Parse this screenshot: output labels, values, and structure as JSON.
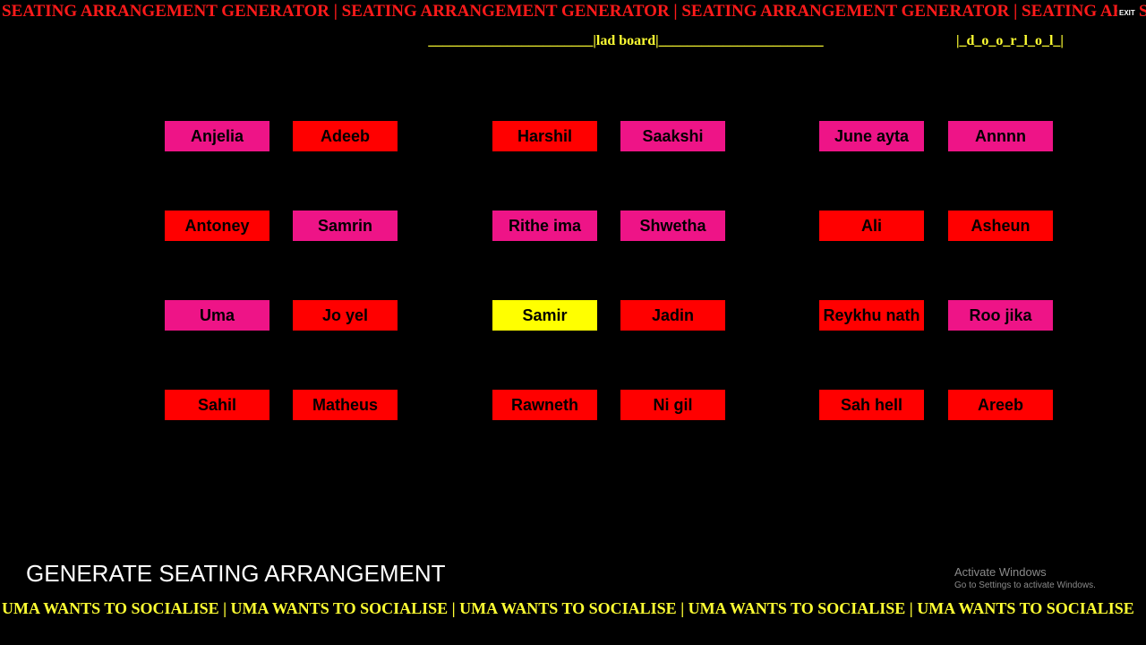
{
  "header": {
    "marquee_text": "SEATING ARRANGEMENT GENERATOR | SEATING ARRANGEMENT GENERATOR | SEATING ARRANGEMENT GENERATOR | SEATING ARRAN",
    "marquee_tail": "S",
    "exit_label": "EXIT",
    "board_label": "_______________________|lad board|_______________________",
    "door_label": "|_d_o_o_r_l_o_l_|"
  },
  "colors": {
    "red": "#ff0000",
    "pink": "#ee1487",
    "yellow": "#ffff00",
    "marquee_top": "#ff1a1a",
    "marquee_bottom": "#ffff33"
  },
  "seats": [
    [
      "Anjelia",
      "Adeeb",
      "Harshil",
      "Saakshi",
      "June ayta",
      "Annnn"
    ],
    [
      "Antoney",
      "Samrin",
      "Rithe ima",
      "Shwetha",
      "Ali",
      "Asheun"
    ],
    [
      "Uma",
      "Jo yel",
      "Samir",
      "Jadin",
      "Reykhu nath",
      "Roo jika"
    ],
    [
      "Sahil",
      "Matheus",
      "Rawneth",
      "Ni gil",
      "Sah hell",
      "Areeb"
    ]
  ],
  "seat_colors": [
    [
      "pink",
      "red",
      "red",
      "pink",
      "pink",
      "pink"
    ],
    [
      "red",
      "pink",
      "pink",
      "pink",
      "red",
      "red"
    ],
    [
      "pink",
      "red",
      "yellow",
      "red",
      "red",
      "pink"
    ],
    [
      "red",
      "red",
      "red",
      "red",
      "red",
      "red"
    ]
  ],
  "footer": {
    "generate_label": "GENERATE SEATING ARRANGEMENT",
    "watermark_title": "Activate Windows",
    "watermark_sub": "Go to Settings to activate Windows.",
    "marquee_text": "UMA WANTS TO SOCIALISE | UMA WANTS TO SOCIALISE | UMA WANTS TO SOCIALISE | UMA WANTS TO SOCIALISE | UMA WANTS TO SOCIALISE"
  }
}
